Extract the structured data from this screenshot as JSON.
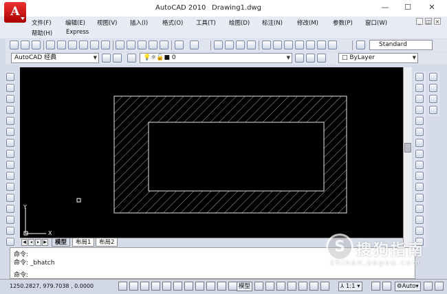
{
  "titlebar": {
    "app_logo": "A",
    "app_name": "AutoCAD 2010",
    "document": "Drawing1.dwg",
    "minimize": "—",
    "maximize": "☐",
    "close": "✕"
  },
  "menu": {
    "row1": [
      "文件(F)",
      "编辑(E)",
      "视图(V)",
      "插入(I)",
      "格式(O)",
      "工具(T)",
      "绘图(D)",
      "标注(N)",
      "修改(M)",
      "参数(P)",
      "窗口(W)"
    ],
    "row2": [
      "帮助(H)",
      "Express"
    ]
  },
  "toolbar": {
    "text_style": "Standard",
    "workspace": "AutoCAD 经典",
    "layer": "0",
    "color": "ByLayer"
  },
  "layout_tabs": [
    "模型",
    "布局1",
    "布局2"
  ],
  "command": {
    "lines": [
      "命令:",
      "命令: _bhatch"
    ],
    "prompt": "命令:"
  },
  "status": {
    "coords": "1250.2827, 979.7038 , 0.0000",
    "model": "模型",
    "scale": "1:1",
    "workspace_auto": "Auto"
  },
  "ucs": {
    "x_label": "X",
    "y_label": "Y"
  },
  "watermark": {
    "text": "搜狗指南",
    "sub": "zhinan.sogou.com"
  }
}
